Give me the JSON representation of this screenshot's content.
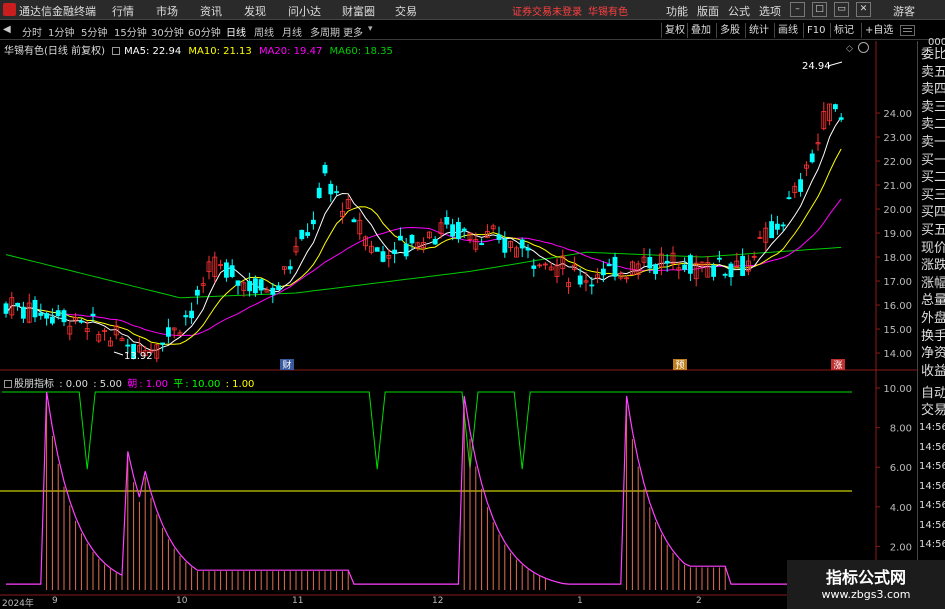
{
  "app": {
    "title": "通达信金融终端",
    "menu": [
      "行情",
      "市场",
      "资讯",
      "发现",
      "问小达",
      "财富圈",
      "交易"
    ],
    "status_message": "证券交易未登录",
    "status_stock": "华锡有色",
    "right_menu": [
      "功能",
      "版面",
      "公式",
      "选项"
    ],
    "guest_label": "游客"
  },
  "period_tabs": [
    "分时",
    "1分钟",
    "5分钟",
    "15分钟",
    "30分钟",
    "60分钟",
    "日线",
    "周线",
    "月线",
    "多周期",
    "更多"
  ],
  "active_period": "日线",
  "toolbar": [
    "复权",
    "叠加",
    "多股",
    "统计",
    "画线",
    "F10",
    "标记",
    "+自选"
  ],
  "main_chart": {
    "stock_title": "华锡有色(日线 前复权)",
    "ma5": "MA5: 22.94",
    "ma10": "MA10: 21.13",
    "ma20": "MA20: 19.47",
    "ma60": "MA60: 18.35",
    "high_label": "24.94",
    "low_label": "13.92",
    "price_axis": [
      "24.00",
      "23.00",
      "22.00",
      "21.00",
      "20.00",
      "19.00",
      "18.00",
      "17.00",
      "16.00",
      "15.00",
      "14.00"
    ],
    "markers": [
      "财",
      "预",
      "涨"
    ],
    "colors": {
      "up": "#ff3232",
      "down": "#00ffff",
      "ma5": "#ffffff",
      "ma10": "#ffff00",
      "ma20": "#ff00ff",
      "ma60": "#00cc00"
    }
  },
  "indicator": {
    "name": "股朋指标",
    "v1": ": 0.00",
    "v2": ": 5.00",
    "chao_label": "朝",
    "chao_value": ": 1.00",
    "ping_label": "平",
    "ping_value": ": 10.00",
    "v3": ": 1.00",
    "axis": [
      "10.00",
      "8.00",
      "6.00",
      "4.00",
      "2.00"
    ]
  },
  "right_panel": {
    "top": "000",
    "items": [
      "委比",
      "卖五",
      "卖四",
      "卖三",
      "卖二",
      "卖一",
      "买一",
      "买二",
      "买三",
      "买四",
      "买五",
      "现价",
      "涨跌",
      "涨幅",
      "总量",
      "外盘",
      "换手",
      "净资",
      "收益"
    ],
    "lower": [
      "自动",
      "交易"
    ],
    "times": [
      "14:56",
      "14:56",
      "14:56",
      "14:56",
      "14:56",
      "14:56",
      "14:56",
      "14:56",
      "14:56"
    ]
  },
  "date_axis": [
    "2024年",
    "9",
    "10",
    "11",
    "12",
    "1",
    "2"
  ],
  "watermark": {
    "title": "指标公式网",
    "url": "www.zbgs3.com"
  }
}
